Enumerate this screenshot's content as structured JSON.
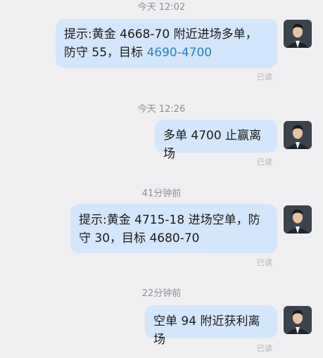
{
  "messages": [
    {
      "time": "今天 12:02",
      "text_prefix": "提示:黄金 4668-70 附近进场多单，防守 55，目标 ",
      "link_text": "4690-4700",
      "status": "已读",
      "avatar": "avatar-icon"
    },
    {
      "time": "今天 12:26",
      "text": "多单 4700 止赢离场",
      "status": "已读",
      "avatar": "avatar-icon"
    },
    {
      "time": "41分钟前",
      "text": "提示:黄金 4715-18 进场空单，防守 30，目标 4680-70",
      "status": "已读",
      "avatar": "avatar-icon"
    },
    {
      "time": "22分钟前",
      "text": "空单 94 附近获利离场",
      "status": "已读",
      "avatar": "avatar-icon"
    }
  ],
  "colors": {
    "background": "#efeff1",
    "bubble": "#d4e6fb",
    "link": "#2a7fdd",
    "timestamp": "#8f8f94"
  }
}
